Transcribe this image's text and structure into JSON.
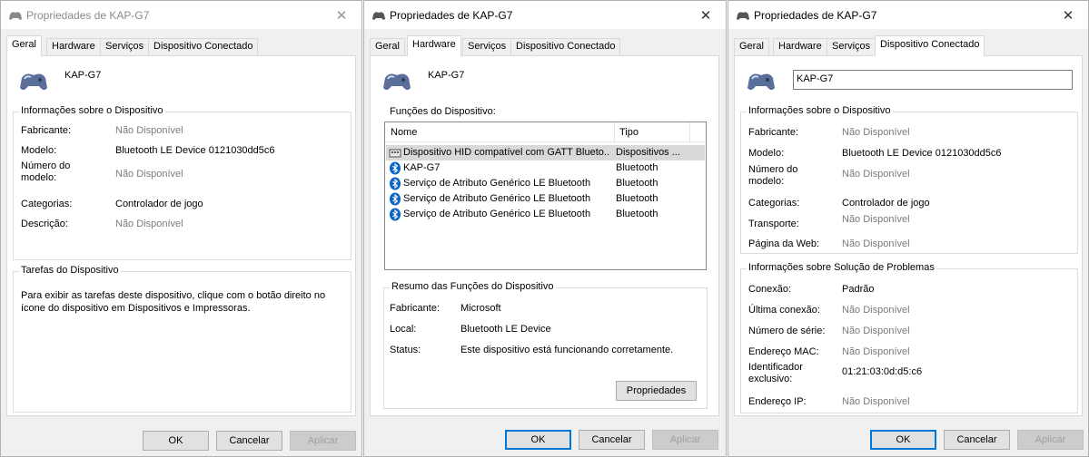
{
  "dialog_title": "Propriedades de KAP-G7",
  "device_name": "KAP-G7",
  "tabs": [
    "Geral",
    "Hardware",
    "Serviços",
    "Dispositivo Conectado"
  ],
  "buttons": {
    "ok": "OK",
    "cancel": "Cancelar",
    "apply": "Aplicar"
  },
  "geral": {
    "info_group": "Informações sobre o Dispositivo",
    "fields": [
      {
        "label": "Fabricante:",
        "value": "Não Disponível"
      },
      {
        "label": "Modelo:",
        "value": "Bluetooth LE Device 0121030dd5c6"
      },
      {
        "label": "Número do modelo:",
        "value": "Não Disponível"
      },
      {
        "label": "Categorias:",
        "value": "Controlador de jogo"
      },
      {
        "label": "Descrição:",
        "value": "Não Disponível"
      }
    ],
    "tasks_group": "Tarefas do Dispositivo",
    "tasks_text": "Para exibir as tarefas deste dispositivo, clique com o botão direito no ícone do dispositivo em Dispositivos e Impressoras."
  },
  "hardware": {
    "functions_label": "Funções do Dispositivo:",
    "columns": [
      "Nome",
      "Tipo"
    ],
    "rows": [
      {
        "name": "Dispositivo HID compatível com GATT Blueto...",
        "type": "Dispositivos ...",
        "icon": "hid-icon",
        "selected": true
      },
      {
        "name": "KAP-G7",
        "type": "Bluetooth",
        "icon": "bluetooth-icon",
        "selected": false
      },
      {
        "name": "Serviço de Atributo Genérico LE Bluetooth",
        "type": "Bluetooth",
        "icon": "bluetooth-icon",
        "selected": false
      },
      {
        "name": "Serviço de Atributo Genérico LE Bluetooth",
        "type": "Bluetooth",
        "icon": "bluetooth-icon",
        "selected": false
      },
      {
        "name": "Serviço de Atributo Genérico LE Bluetooth",
        "type": "Bluetooth",
        "icon": "bluetooth-icon",
        "selected": false
      }
    ],
    "summary_group": "Resumo das Funções do Dispositivo",
    "summary": [
      {
        "label": "Fabricante:",
        "value": "Microsoft"
      },
      {
        "label": "Local:",
        "value": "Bluetooth LE Device"
      },
      {
        "label": "Status:",
        "value": "Este dispositivo está funcionando corretamente."
      }
    ],
    "properties_button": "Propriedades"
  },
  "conectado": {
    "name_value": "KAP-G7",
    "info_group": "Informações sobre o Dispositivo",
    "info": [
      {
        "label": "Fabricante:",
        "value": "Não Disponível"
      },
      {
        "label": "Modelo:",
        "value": "Bluetooth LE Device 0121030dd5c6"
      },
      {
        "label": "Número do modelo:",
        "value": "Não Disponível"
      },
      {
        "label": "Categorias:",
        "value": "Controlador de jogo"
      },
      {
        "label": "Transporte:",
        "value": "Não Disponível"
      },
      {
        "label": "Página da Web:",
        "value": "Não Disponível"
      }
    ],
    "trouble_group": "Informações sobre Solução de Problemas",
    "trouble": [
      {
        "label": "Conexão:",
        "value": "Padrão"
      },
      {
        "label": "Última conexão:",
        "value": "Não Disponível"
      },
      {
        "label": "Número de série:",
        "value": "Não Disponível"
      },
      {
        "label": "Endereço MAC:",
        "value": "Não Disponível"
      },
      {
        "label": "Identificador exclusivo:",
        "value": "01:21:03:0d:d5:c6"
      },
      {
        "label": "Endereço IP:",
        "value": "Não Disponível"
      }
    ]
  },
  "colors": {
    "accent": "#0078d7",
    "bluetooth": "#0a64c8",
    "disabled_text": "#7a7a7a"
  }
}
